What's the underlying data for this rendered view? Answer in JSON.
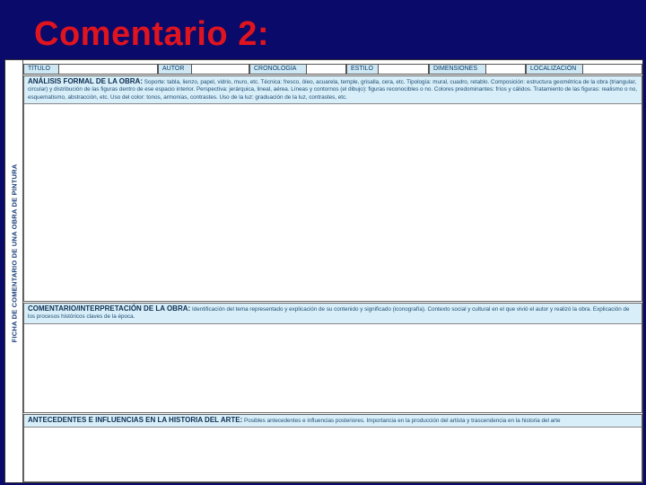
{
  "slide": {
    "title": "Comentario 2:"
  },
  "sheet": {
    "side_label": "FICHA DE COMENTARIO DE UNA OBRA DE PINTURA",
    "header_fields": [
      {
        "label": "TÍTULO"
      },
      {
        "label": "AUTOR"
      },
      {
        "label": "CRONOLOGÍA"
      },
      {
        "label": "ESTILO"
      },
      {
        "label": "DIMENSIONES"
      },
      {
        "label": "LOCALIZACIÓN"
      }
    ],
    "sections": [
      {
        "heading": "ANÁLISIS FORMAL DE LA OBRA:",
        "text": "Soporte: tabla, lienzo, papel, vidrio, muro, etc. Técnica: fresco, óleo, acuarela, temple, grisalla, cera, etc. Tipología: mural, cuadro, retablo. Composición: estructura geométrica de la obra (triangular, circular) y distribución de las figuras dentro de ese espacio interior. Perspectiva: jerárquica, lineal, aérea. Líneas y contornos (el dibujo): figuras reconocibles o no. Colores predominantes: fríos y cálidos. Tratamiento de las figuras: realismo o no, esquematismo, abstracción, etc. Uso del color: tonos, armonías, contrastes. Uso de la luz: graduación de la luz, contrastes, etc."
      },
      {
        "heading": "COMENTARIO/INTERPRETACIÓN DE LA OBRA:",
        "text": "Identificación del tema representado y explicación de su contenido y significado (iconografía). Contexto social y cultural en el que vivió el autor y realizó la obra. Explicación de los procesos históricos claves de la época."
      },
      {
        "heading": "ANTECEDENTES E INFLUENCIAS EN LA HISTORIA DEL ARTE:",
        "text": "Posibles antecedentes e influencias posteriores. Importancia en la producción del artista y trascendencia en la historia del arte"
      }
    ]
  }
}
